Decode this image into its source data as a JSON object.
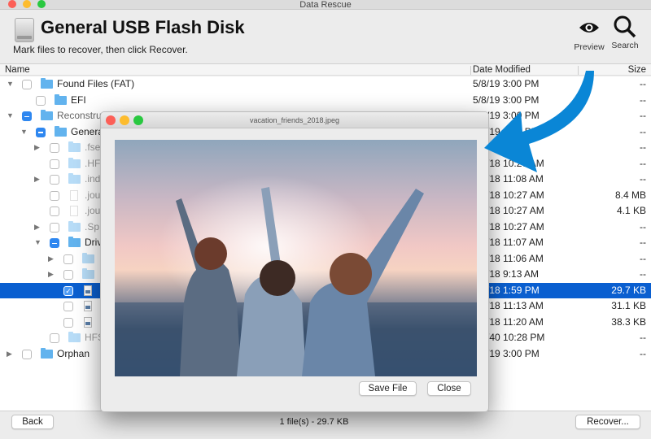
{
  "window": {
    "title": "Data Rescue"
  },
  "header": {
    "title": "General USB Flash Disk",
    "subtitle": "Mark files to recover, then click Recover.",
    "preview_label": "Preview",
    "search_label": "Search"
  },
  "table": {
    "columns": {
      "name": "Name",
      "date": "Date Modified",
      "size": "Size"
    },
    "rows": [
      {
        "level": 0,
        "expander": "expanded",
        "check": "none",
        "icon": "folder",
        "name": "Found Files (FAT)",
        "date": "5/8/19 3:00 PM",
        "size": "--"
      },
      {
        "level": 1,
        "expander": "none",
        "check": "none",
        "icon": "folder",
        "name": "EFI",
        "date": "5/8/19 3:00 PM",
        "size": "--"
      },
      {
        "level": 0,
        "expander": "expanded",
        "check": "mixed",
        "icon": "folder",
        "name": "Reconstruc",
        "date": "/19 3:00 PM",
        "size": "--",
        "nameDim": true
      },
      {
        "level": 1,
        "expander": "expanded",
        "check": "mixed",
        "icon": "folder",
        "name": "Genera",
        "date": "/19 3:00 PM",
        "size": "--"
      },
      {
        "level": 2,
        "expander": "collapsed",
        "check": "none",
        "icon": "folder",
        "name": ".fse",
        "date": "",
        "size": "--",
        "dim": true
      },
      {
        "level": 2,
        "expander": "none",
        "check": "none",
        "icon": "folder",
        "name": ".HF",
        "date": "/18 10:27 AM",
        "size": "--",
        "dim": true
      },
      {
        "level": 2,
        "expander": "collapsed",
        "check": "none",
        "icon": "folder",
        "name": ".ind",
        "date": "/18 11:08 AM",
        "size": "--",
        "dim": true
      },
      {
        "level": 2,
        "expander": "none",
        "check": "none",
        "icon": "file",
        "name": ".jou",
        "date": "/18 10:27 AM",
        "size": "8.4 MB",
        "dim": true
      },
      {
        "level": 2,
        "expander": "none",
        "check": "none",
        "icon": "file",
        "name": ".jou",
        "date": "/18 10:27 AM",
        "size": "4.1 KB",
        "dim": true
      },
      {
        "level": 2,
        "expander": "collapsed",
        "check": "none",
        "icon": "folder",
        "name": ".Sp",
        "date": "/18 10:27 AM",
        "size": "--",
        "dim": true
      },
      {
        "level": 2,
        "expander": "expanded",
        "check": "mixed",
        "icon": "folder",
        "name": "Driv",
        "date": "/18 11:07 AM",
        "size": "--"
      },
      {
        "level": 3,
        "expander": "collapsed",
        "check": "none",
        "icon": "folder",
        "name": "",
        "date": "/18 11:06 AM",
        "size": "--",
        "dim": true
      },
      {
        "level": 3,
        "expander": "collapsed",
        "check": "none",
        "icon": "folder",
        "name": "",
        "date": "/18 9:13 AM",
        "size": "--",
        "dim": true
      },
      {
        "level": 3,
        "expander": "none",
        "check": "checked",
        "icon": "image",
        "name": "",
        "date": "/18 1:59 PM",
        "size": "29.7 KB",
        "selected": true
      },
      {
        "level": 3,
        "expander": "none",
        "check": "none",
        "icon": "image",
        "name": "",
        "date": "/18 11:13 AM",
        "size": "31.1 KB"
      },
      {
        "level": 3,
        "expander": "none",
        "check": "none",
        "icon": "image",
        "name": "",
        "date": "/18 11:20 AM",
        "size": "38.3 KB"
      },
      {
        "level": 2,
        "expander": "none",
        "check": "none",
        "icon": "folder",
        "name": "HFS",
        "date": "/40 10:28 PM",
        "size": "--",
        "dim": true
      },
      {
        "level": 0,
        "expander": "collapsed",
        "check": "none",
        "icon": "folder",
        "name": "Orphan",
        "date": "/19 3:00 PM",
        "size": "--"
      }
    ]
  },
  "preview": {
    "title": "vacation_friends_2018.jpeg",
    "save_label": "Save File",
    "close_label": "Close"
  },
  "footer": {
    "back_label": "Back",
    "status": "1 file(s) - 29.7 KB",
    "recover_label": "Recover..."
  },
  "colors": {
    "selection": "#0a5fd0",
    "checkbox": "#2e87f0",
    "folder": "#62b3ee",
    "arrow": "#0a86d6"
  }
}
